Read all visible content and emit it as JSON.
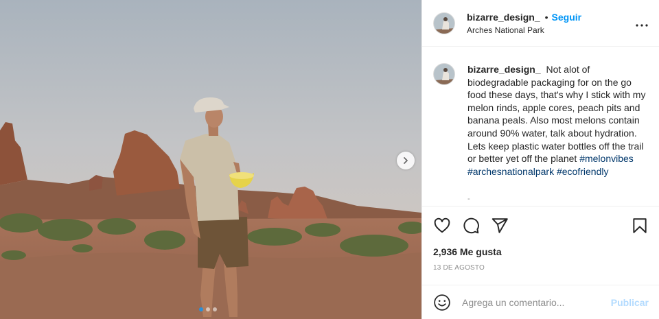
{
  "post": {
    "username": "bizarre_design_",
    "separator": "•",
    "follow_label": "Seguir",
    "location": "Arches National Park",
    "caption_text": "Not alot of biodegradable packaging for on the go food these days, that's why I stick with my melon rinds, apple cores, peach pits and banana peals. Also most melons contain around 90% water, talk about hydration. Lets keep plastic water bottles off the trail or better yet off the planet",
    "hashtags": [
      "#melonvibes",
      "#archesnationalpark",
      "#ecofriendly"
    ],
    "caption_more": "-",
    "likes": "2,936 Me gusta",
    "date": "13 DE AGOSTO"
  },
  "comment": {
    "placeholder": "Agrega un comentario...",
    "publish_label": "Publicar"
  },
  "carousel": {
    "dots": 3,
    "active_index": 0
  },
  "icons": [
    "heart-icon",
    "comment-icon",
    "share-icon",
    "bookmark-icon",
    "emoji-icon",
    "more-icon",
    "chevron-right-icon"
  ],
  "colors": {
    "link_blue": "#0095f6",
    "hashtag": "#00376b",
    "publish_disabled": "#b3dbff",
    "muted": "#8e8e8e"
  }
}
